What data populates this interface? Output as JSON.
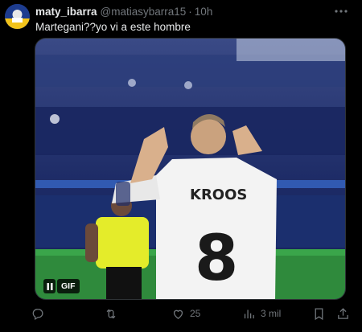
{
  "tweet": {
    "author_name": "maty_ibarra",
    "author_handle": "@matiasybarra15",
    "separator": "·",
    "time": "10h",
    "text": "Martegani??yo vi a este hombre"
  },
  "media": {
    "type": "gif",
    "jersey_name": "KROOS",
    "jersey_number": "8",
    "gif_label": "GIF"
  },
  "actions": {
    "reply_count": "",
    "retweet_count": "",
    "like_count": "25",
    "views_count": "3 mil"
  },
  "icons": {
    "more": "more-dots-icon",
    "pause": "pause-icon",
    "reply": "reply-icon",
    "retweet": "retweet-icon",
    "like": "heart-icon",
    "views": "views-chart-icon",
    "bookmark": "bookmark-icon",
    "share": "share-icon"
  },
  "colors": {
    "background": "#000000",
    "text_primary": "#e7e9ea",
    "text_secondary": "#71767b",
    "border": "#2f3336"
  }
}
